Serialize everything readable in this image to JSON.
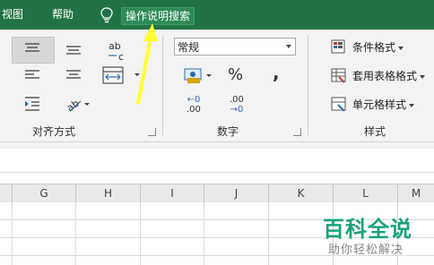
{
  "menubar": {
    "tabs": [
      {
        "label": "视图"
      },
      {
        "label": "帮助"
      }
    ],
    "tell_me": "操作说明搜索"
  },
  "ribbon": {
    "alignment": {
      "label": "对齐方式"
    },
    "number": {
      "label": "数字",
      "format_value": "常规",
      "percent_symbol": "%",
      "comma_symbol": ",",
      "increase_decimal_top": "←0",
      "increase_decimal_bottom": ".00",
      "decrease_decimal_top": ".00",
      "decrease_decimal_bottom": "→0"
    },
    "styles": {
      "label": "样式",
      "conditional_formatting": "条件格式",
      "format_as_table": "套用表格格式",
      "cell_styles": "单元格样式"
    }
  },
  "grid": {
    "columns": [
      "G",
      "H",
      "I",
      "J",
      "K",
      "L",
      "M"
    ]
  },
  "watermark": {
    "title": "百科全说",
    "subtitle": "助你轻松解决"
  },
  "colors": {
    "menubar": "#217346",
    "watermark": "#1aa37a",
    "annotation_arrow": "#ffff33"
  }
}
